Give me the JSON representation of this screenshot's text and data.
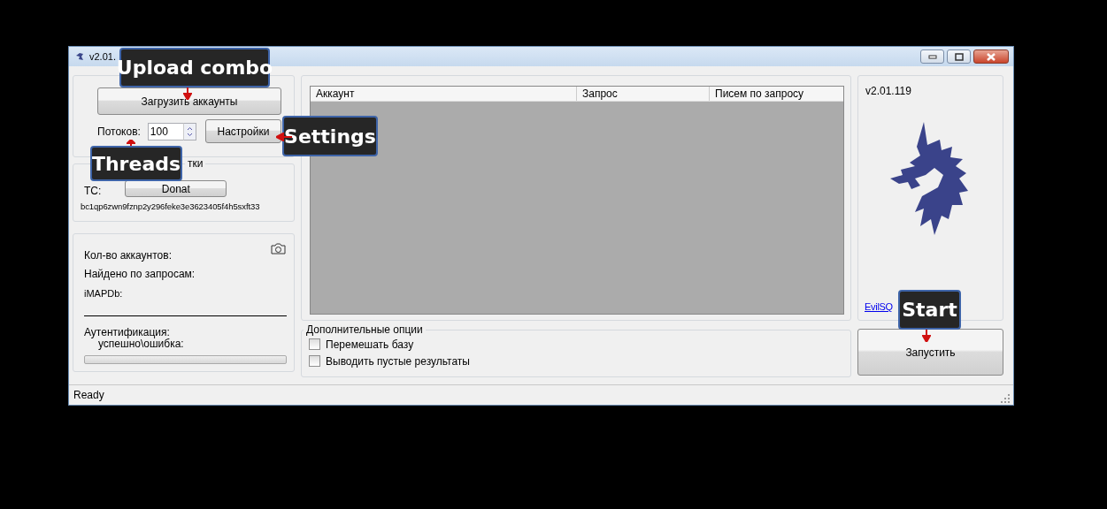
{
  "window": {
    "title": "v2.01."
  },
  "load_button": "Загрузить аккаунты",
  "threads": {
    "label": "Потоков:",
    "value": "100"
  },
  "settings_button": "Настройки",
  "support": {
    "title_fragment": "тки",
    "btc_label": "TC:",
    "donate_button": "Donat",
    "address": "bc1qp6zwn9fznp2y296feke3e3623405f4h5sxft33"
  },
  "stats": {
    "accounts_label": "Кол-во аккаунтов:",
    "found_label": "Найдено по запросам:",
    "imap_label": "iMAPDb:",
    "auth_label": "Аутентификация:",
    "auth_result_label": "успешно\\ошибка:",
    "progress": {
      "level": 0
    }
  },
  "table": {
    "columns": [
      "Аккаунт",
      "Запрос",
      "Писем по запросу"
    ]
  },
  "options": {
    "title": "Дополнительные опции",
    "items": [
      {
        "label": "Перемешать базу",
        "checked": false
      },
      {
        "label": "Выводить пустые результаты",
        "checked": false
      }
    ]
  },
  "about": {
    "version": "v2.01.119",
    "link": "EvilSQ"
  },
  "start_button": "Запустить",
  "status_bar": "Ready",
  "callouts": [
    {
      "text": "Upload combo"
    },
    {
      "text": "Threads"
    },
    {
      "text": "Settings"
    },
    {
      "text": "Start"
    }
  ]
}
